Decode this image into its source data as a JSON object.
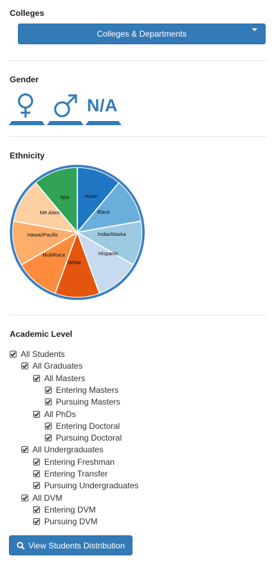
{
  "colleges": {
    "title": "Colleges",
    "dropdown_label": "Colleges & Departments"
  },
  "gender": {
    "title": "Gender",
    "options": [
      {
        "icon": "female-symbol-icon"
      },
      {
        "icon": "male-symbol-icon"
      },
      {
        "label": "N/A"
      }
    ]
  },
  "ethnicity": {
    "title": "Ethnicity",
    "slices": [
      {
        "label": "Asian",
        "color": "#1f77c4"
      },
      {
        "label": "Black",
        "color": "#6aaedc"
      },
      {
        "label": "India/Alaska",
        "color": "#9ecae1"
      },
      {
        "label": "Hispanic",
        "color": "#c6dbef"
      },
      {
        "label": "White",
        "color": "#e6550d"
      },
      {
        "label": "MultiRace",
        "color": "#fd8d3c"
      },
      {
        "label": "Hawai/Pacific",
        "color": "#fdae6b"
      },
      {
        "label": "NR Alien",
        "color": "#fdd0a2"
      },
      {
        "label": "N/A",
        "color": "#31a354"
      }
    ],
    "ring_color": "#3a7fc1"
  },
  "academic": {
    "title": "Academic Level",
    "items": [
      {
        "label": "All Students",
        "level": 0,
        "checked": true
      },
      {
        "label": "All Graduates",
        "level": 1,
        "checked": true
      },
      {
        "label": "All Masters",
        "level": 2,
        "checked": true
      },
      {
        "label": "Entering Masters",
        "level": 3,
        "checked": true
      },
      {
        "label": "Pursuing Masters",
        "level": 3,
        "checked": true
      },
      {
        "label": "All PhDs",
        "level": 2,
        "checked": true
      },
      {
        "label": "Entering Doctoral",
        "level": 3,
        "checked": true
      },
      {
        "label": "Pursuing Doctoral",
        "level": 3,
        "checked": true
      },
      {
        "label": "All Undergraduates",
        "level": 1,
        "checked": true
      },
      {
        "label": "Entering Freshman",
        "level": 2,
        "checked": true
      },
      {
        "label": "Entering Transfer",
        "level": 2,
        "checked": true
      },
      {
        "label": "Pursuing Undergraduates",
        "level": 2,
        "checked": true
      },
      {
        "label": "All DVM",
        "level": 1,
        "checked": true
      },
      {
        "label": "Entering DVM",
        "level": 2,
        "checked": true
      },
      {
        "label": "Pursuing DVM",
        "level": 2,
        "checked": true
      }
    ]
  },
  "view_button": {
    "label": "View Students Distribution",
    "icon": "search-icon"
  },
  "colors": {
    "primary": "#337ab7"
  }
}
